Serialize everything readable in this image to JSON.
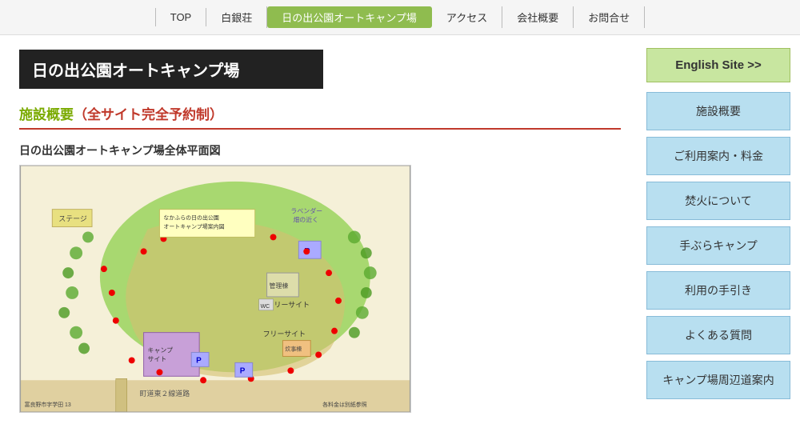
{
  "nav": {
    "items": [
      {
        "label": "TOP",
        "active": false
      },
      {
        "label": "白銀荘",
        "active": false
      },
      {
        "label": "日の出公園オートキャンプ場",
        "active": true
      },
      {
        "label": "アクセス",
        "active": false
      },
      {
        "label": "会社概要",
        "active": false
      },
      {
        "label": "お問合せ",
        "active": false
      }
    ]
  },
  "page": {
    "header_title": "日の出公園オートキャンプ場",
    "section_heading_prefix": "施設概要",
    "section_heading_highlight": "（全サイト完全予約制）",
    "map_title": "日の出公園オートキャンプ場全体平面図"
  },
  "sidebar": {
    "english_btn": "English Site >>",
    "buttons": [
      "施設概要",
      "ご利用案内・料金",
      "焚火について",
      "手ぶらキャンプ",
      "利用の手引き",
      "よくある質問",
      "キャンプ場周辺道案内"
    ]
  }
}
